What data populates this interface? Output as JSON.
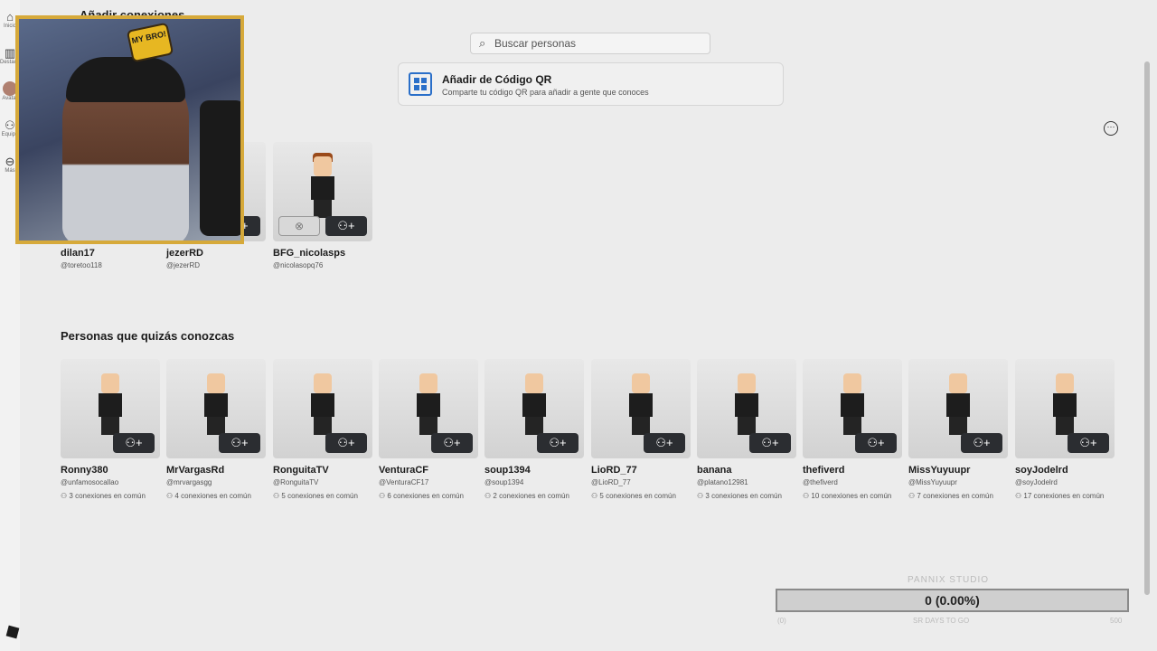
{
  "nav": [
    {
      "icon": "home-icon",
      "glyph": "⌂",
      "label": "Inicio"
    },
    {
      "icon": "charts-icon",
      "glyph": "▥",
      "label": "Destacados"
    },
    {
      "icon": "avatar-icon",
      "glyph": "",
      "label": "Avatar"
    },
    {
      "icon": "group-icon",
      "glyph": "⚇",
      "label": "Equipo"
    },
    {
      "icon": "more-icon",
      "glyph": "⊖",
      "label": "Más"
    }
  ],
  "header": {
    "back_glyph": "←",
    "title": "Añadir conexiones"
  },
  "search": {
    "icon": "⌕",
    "placeholder": "Buscar personas"
  },
  "qr": {
    "title": "Añadir de Código QR",
    "subtitle": "Comparte tu código QR para añadir a gente que conoces"
  },
  "more_glyph": "⋯",
  "requests": [
    {
      "name": "dilan17",
      "handle": "@toretoo118"
    },
    {
      "name": "jezerRD",
      "handle": "@jezerRD"
    },
    {
      "name": "BFG_nicolasps",
      "handle": "@nicolasopq76"
    }
  ],
  "suggested_title": "Personas que quizás conozcas",
  "suggestions": [
    {
      "name": "Ronny380",
      "handle": "@unfamosocallao",
      "mutual": "3 conexiones en común"
    },
    {
      "name": "MrVargasRd",
      "handle": "@mrvargasgg",
      "mutual": "4 conexiones en común"
    },
    {
      "name": "RonguitaTV",
      "handle": "@RonguitaTV",
      "mutual": "5 conexiones en común"
    },
    {
      "name": "VenturaCF",
      "handle": "@VenturaCF17",
      "mutual": "6 conexiones en común"
    },
    {
      "name": "soup1394",
      "handle": "@soup1394",
      "mutual": "2 conexiones en común"
    },
    {
      "name": "LioRD_77",
      "handle": "@LioRD_77",
      "mutual": "5 conexiones en común"
    },
    {
      "name": "banana",
      "handle": "@platano12981",
      "mutual": "3 conexiones en común"
    },
    {
      "name": "thefiverd",
      "handle": "@thefiverd",
      "mutual": "10 conexiones en común"
    },
    {
      "name": "MissYuyuupr",
      "handle": "@MissYuyuupr",
      "mutual": "7 conexiones en común"
    },
    {
      "name": "soyJodelrd",
      "handle": "@soyJodelrd",
      "mutual": "17 conexiones en común"
    }
  ],
  "add_glyph": "⚇+",
  "dismiss_glyph": "⊗",
  "mutual_glyph": "⚇",
  "webcam_badge": "MY BRO!",
  "overlay": {
    "label": "PANNIX STUDIO",
    "progress": "0 (0.00%)",
    "left": "(0)",
    "mid": "SR DAYS TO GO",
    "right": "500"
  },
  "colors": {
    "accent": "#2a6fc9",
    "button": "#2b2d31",
    "webcam_frame": "#d6a93a"
  }
}
